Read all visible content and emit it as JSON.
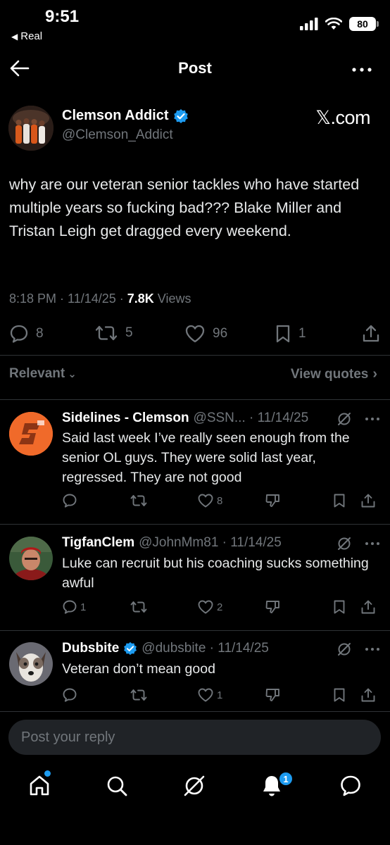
{
  "status_bar": {
    "time": "9:51",
    "back_app": "Real",
    "battery": "80"
  },
  "nav": {
    "title": "Post"
  },
  "post": {
    "author_name": "Clemson Addict",
    "author_handle": "@Clemson_Addict",
    "source_brand": "𝕏.com",
    "text": "why are our veteran senior tackles who have started multiple years so fucking bad??? Blake Miller and Tristan Leigh get dragged every weekend.",
    "time": "8:18 PM · 11/14/25 · ",
    "views_count": "7.8K",
    "views_label": " Views",
    "replies": "8",
    "reposts": "5",
    "likes": "96",
    "bookmarks": "1"
  },
  "filter": {
    "sort_label": "Relevant",
    "quotes_label": "View quotes"
  },
  "replies": [
    {
      "name": "Sidelines - Clemson",
      "meta": "@SSN... · 11/14/25",
      "text": "Said last week I’ve really seen enough from the senior OL guys. They were solid last year, regressed. They are not good",
      "replies": "",
      "likes": "8"
    },
    {
      "name": "TigfanClem",
      "meta": "@JohnMm81 · 11/14/25",
      "text": "Luke can recruit but his coaching sucks something awful",
      "replies": "1",
      "likes": "2"
    },
    {
      "name": "Dubsbite",
      "meta": "@dubsbite · 11/14/25",
      "text": "Veteran don’t mean good",
      "replies": "",
      "likes": "1"
    }
  ],
  "composer": {
    "placeholder": "Post your reply"
  },
  "tabbar": {
    "notifications_badge": "1"
  },
  "colors": {
    "accent": "#1d9bf0",
    "muted": "#71767b",
    "background": "#000000"
  }
}
